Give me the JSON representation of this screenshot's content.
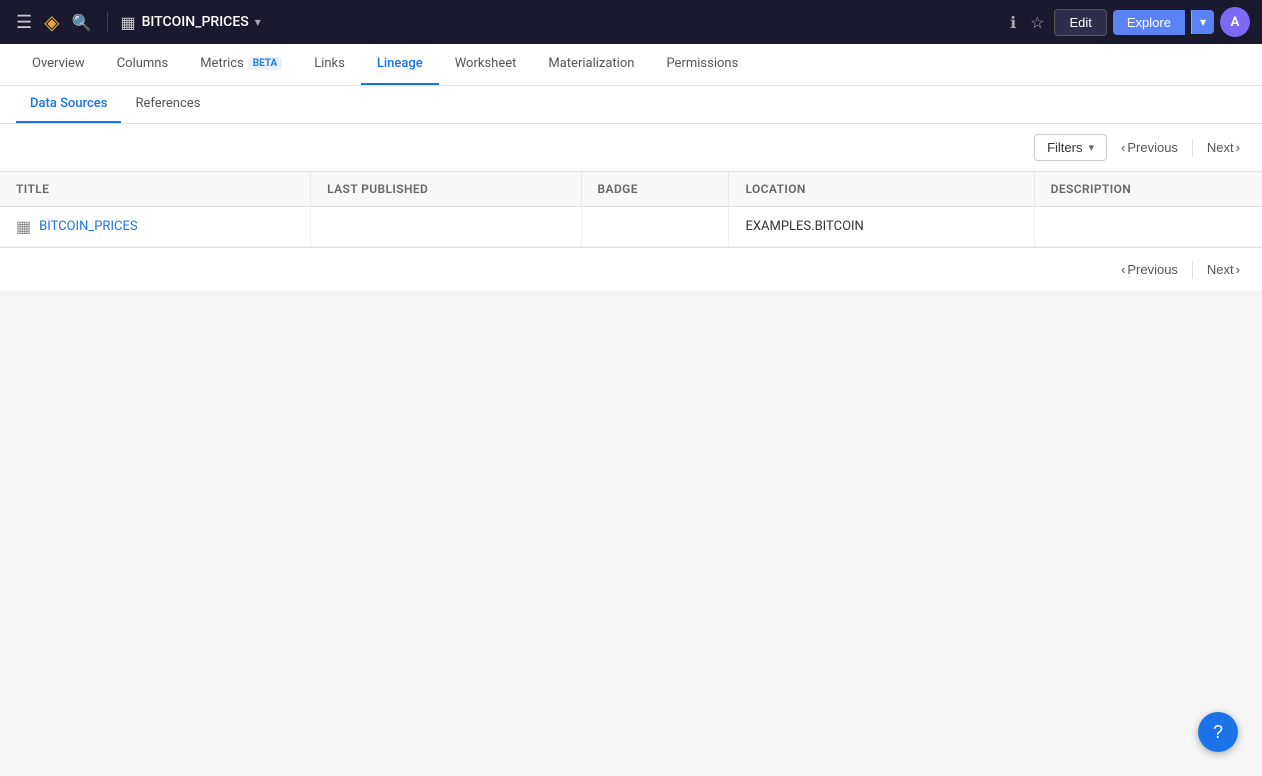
{
  "topbar": {
    "menu_icon": "☰",
    "logo_icon": "◈",
    "search_icon": "🔍",
    "dataset_icon": "▦",
    "dataset_name": "BITCOIN_PRICES",
    "chevron_down": "▾",
    "info_icon": "ℹ",
    "star_icon": "☆",
    "edit_label": "Edit",
    "explore_label": "Explore",
    "explore_dropdown_icon": "▾",
    "avatar_initials": "A"
  },
  "tabs": [
    {
      "label": "Overview",
      "active": false
    },
    {
      "label": "Columns",
      "active": false
    },
    {
      "label": "Metrics",
      "active": false,
      "badge": "BETA"
    },
    {
      "label": "Links",
      "active": false
    },
    {
      "label": "Lineage",
      "active": true
    },
    {
      "label": "Worksheet",
      "active": false
    },
    {
      "label": "Materialization",
      "active": false
    },
    {
      "label": "Permissions",
      "active": false
    }
  ],
  "subtabs": [
    {
      "label": "Data Sources",
      "active": true
    },
    {
      "label": "References",
      "active": false
    }
  ],
  "toolbar": {
    "filters_label": "Filters",
    "filters_dropdown": "▾",
    "prev_icon": "‹",
    "next_icon": "›",
    "previous_label": "Previous",
    "next_label": "Next"
  },
  "table": {
    "columns": [
      {
        "key": "title",
        "label": "Title"
      },
      {
        "key": "last_published",
        "label": "Last Published"
      },
      {
        "key": "badge",
        "label": "Badge"
      },
      {
        "key": "location",
        "label": "Location"
      },
      {
        "key": "description",
        "label": "Description"
      }
    ],
    "rows": [
      {
        "title": "BITCOIN_PRICES",
        "row_icon": "▦",
        "last_published": "",
        "badge": "",
        "location": "EXAMPLES.BITCOIN",
        "description": ""
      }
    ]
  },
  "help_icon": "?"
}
